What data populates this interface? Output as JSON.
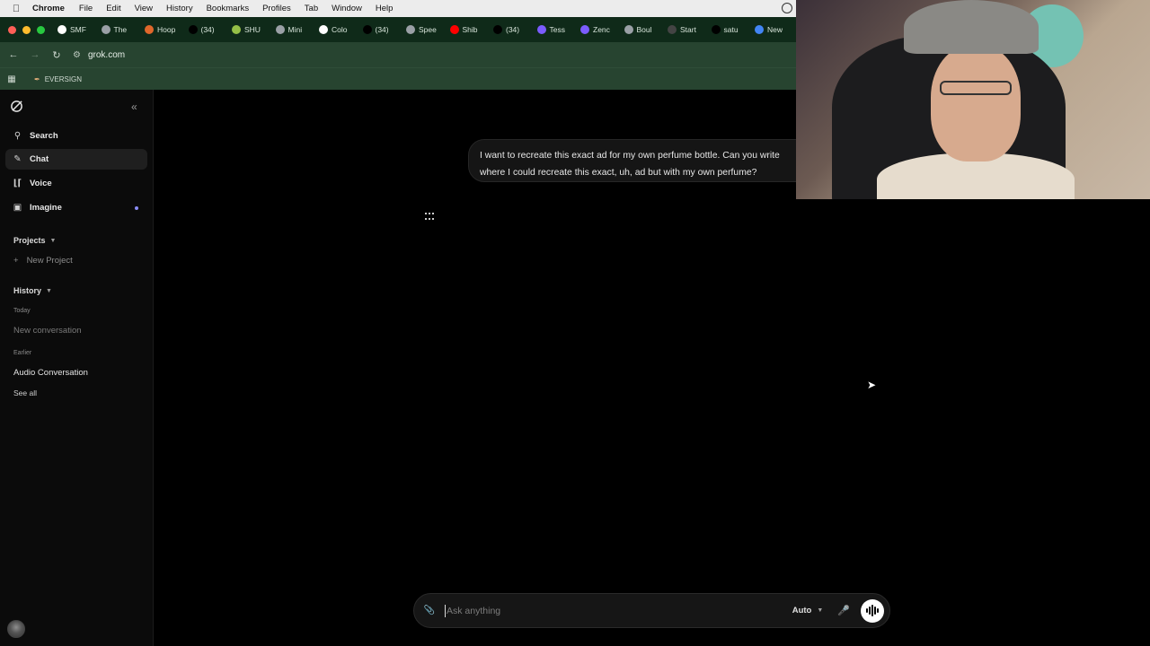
{
  "menubar": {
    "app": "Chrome",
    "items": [
      "File",
      "Edit",
      "View",
      "History",
      "Bookmarks",
      "Profiles",
      "Tab",
      "Window",
      "Help"
    ]
  },
  "tabs": [
    {
      "label": "SMF",
      "icon": "gmail-icon",
      "color": "#ffffff"
    },
    {
      "label": "The",
      "icon": "globe-icon",
      "color": "#9aa0a6"
    },
    {
      "label": "Hoop",
      "icon": "basketball-icon",
      "color": "#e0672b"
    },
    {
      "label": "(34)",
      "icon": "tiktok-icon",
      "color": "#000000"
    },
    {
      "label": "SHU",
      "icon": "shopify-icon",
      "color": "#95bf47"
    },
    {
      "label": "Mini",
      "icon": "globe-icon",
      "color": "#9aa0a6"
    },
    {
      "label": "Colo",
      "icon": "chatgpt-icon",
      "color": "#ffffff"
    },
    {
      "label": "(34)",
      "icon": "tiktok-icon",
      "color": "#000000"
    },
    {
      "label": "Spee",
      "icon": "globe-icon",
      "color": "#9aa0a6"
    },
    {
      "label": "Shib",
      "icon": "youtube-icon",
      "color": "#ff0000"
    },
    {
      "label": "(34)",
      "icon": "tiktok-icon",
      "color": "#000000"
    },
    {
      "label": "Tess",
      "icon": "tessera-icon",
      "color": "#7b5cff"
    },
    {
      "label": "Zenc",
      "icon": "zencoder-icon",
      "color": "#7b5cff"
    },
    {
      "label": "Boul",
      "icon": "globe-icon",
      "color": "#9aa0a6"
    },
    {
      "label": "Start",
      "icon": "box-icon",
      "color": "#444444"
    },
    {
      "label": "satu",
      "icon": "tiktok-icon",
      "color": "#000000"
    },
    {
      "label": "New",
      "icon": "chrome-icon",
      "color": "#4285f4"
    }
  ],
  "address": {
    "url": "grok.com"
  },
  "bookmarks": {
    "items": [
      {
        "label": "EVERSIGN",
        "icon": "pen-icon"
      }
    ]
  },
  "sidebar": {
    "nav": [
      {
        "label": "Search",
        "icon": "search-icon"
      },
      {
        "label": "Chat",
        "icon": "chat-icon",
        "active": true
      },
      {
        "label": "Voice",
        "icon": "waveform-icon"
      },
      {
        "label": "Imagine",
        "icon": "image-icon",
        "badge_dot": true
      }
    ],
    "projects_label": "Projects",
    "new_project": "New Project",
    "history_label": "History",
    "today_label": "Today",
    "today_items": [
      "New conversation"
    ],
    "earlier_label": "Earlier",
    "earlier_items": [
      "Audio Conversation"
    ],
    "see_all": "See all"
  },
  "conversation": {
    "user_message_line1": "I want to recreate this exact ad for my own perfume bottle. Can you write",
    "user_message_line2": "where I could recreate this exact, uh, ad but with my own perfume?"
  },
  "composer": {
    "placeholder": "Ask anything",
    "model": "Auto"
  },
  "colors": {
    "browser_chrome": "#274430",
    "tab_strip": "#0f2a19",
    "accent_dot": "#8a8cf5"
  }
}
